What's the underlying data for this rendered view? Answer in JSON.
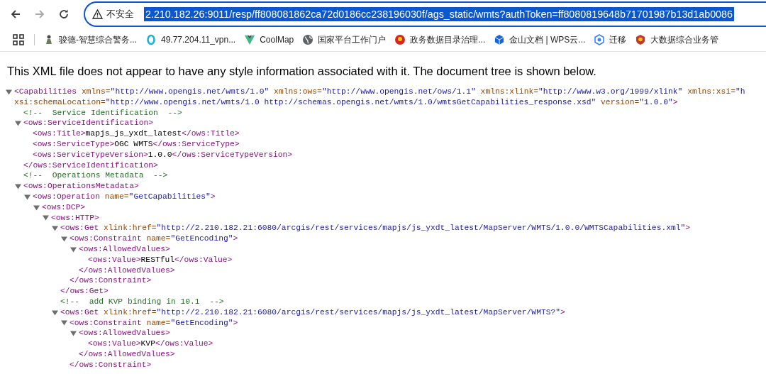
{
  "browser": {
    "nav": [
      {
        "kind": "back",
        "disabled": false
      },
      {
        "kind": "forward",
        "disabled": true
      },
      {
        "kind": "reload",
        "disabled": false
      }
    ],
    "omnibox": {
      "security_label": "不安全",
      "url": "2.210.182.26:9011/resp/ff808081862ca72d0186cc238196030f/ags_static/wmts?authToken=ff8080819648b71701987b13d1ab0086",
      "selected": true
    },
    "bookmarks": [
      {
        "kind": "figure",
        "label": "骏德-智慧综合警务..."
      },
      {
        "kind": "ring",
        "label": "49.77.204.11_vpn..."
      },
      {
        "kind": "vee",
        "label": "CoolMap"
      },
      {
        "kind": "globe",
        "label": "国家平台工作门户"
      },
      {
        "kind": "emblem",
        "label": "政务数据目录治理..."
      },
      {
        "kind": "cube",
        "label": "金山文档 | WPS云..."
      },
      {
        "kind": "hex",
        "label": "迁移"
      },
      {
        "kind": "badge",
        "label": "大数据综合业务管"
      }
    ]
  },
  "page": {
    "notice": "This XML file does not appear to have any style information associated with it. The document tree is shown below.",
    "tree": {
      "expanded": true,
      "lines": [
        [
          {
            "kind": "tag",
            "text": "<Capabilities"
          },
          {
            "kind": "attr",
            "text": " xmlns="
          },
          {
            "kind": "value",
            "text": "\"http://www.opengis.net/wmts/1.0\""
          },
          {
            "kind": "attr",
            "text": " xmlns:ows="
          },
          {
            "kind": "value",
            "text": "\"http://www.opengis.net/ows/1.1\""
          },
          {
            "kind": "attr",
            "text": " xmlns:xlink="
          },
          {
            "kind": "value",
            "text": "\"http://www.w3.org/1999/xlink\""
          },
          {
            "kind": "attr",
            "text": " xmlns:xsi="
          },
          {
            "kind": "value",
            "text": "\"h"
          }
        ],
        [
          {
            "kind": "attr",
            "text": "xsi:schemaLocation="
          },
          {
            "kind": "value",
            "text": "\"http://www.opengis.net/wmts/1.0 http://schemas.opengis.net/wmts/1.0/wmtsGetCapabilities_response.xsd\""
          },
          {
            "kind": "attr",
            "text": " version="
          },
          {
            "kind": "value",
            "text": "\"1.0.0\""
          },
          {
            "kind": "tag",
            "text": ">"
          }
        ]
      ],
      "children": [
        {
          "lines": [
            [
              {
                "kind": "comment",
                "text": "<!--  Service Identification  -->"
              }
            ]
          ]
        },
        {
          "expanded": true,
          "lines": [
            [
              {
                "kind": "tag",
                "text": "<ows:ServiceIdentification>"
              }
            ]
          ],
          "children": [
            {
              "lines": [
                [
                  {
                    "kind": "tag",
                    "text": "<ows:Title>"
                  },
                  {
                    "kind": "text",
                    "text": "mapjs_js_yxdt_latest"
                  },
                  {
                    "kind": "tag",
                    "text": "</ows:Title>"
                  }
                ]
              ]
            },
            {
              "lines": [
                [
                  {
                    "kind": "tag",
                    "text": "<ows:ServiceType>"
                  },
                  {
                    "kind": "text",
                    "text": "OGC WMTS"
                  },
                  {
                    "kind": "tag",
                    "text": "</ows:ServiceType>"
                  }
                ]
              ]
            },
            {
              "lines": [
                [
                  {
                    "kind": "tag",
                    "text": "<ows:ServiceTypeVersion>"
                  },
                  {
                    "kind": "text",
                    "text": "1.0.0"
                  },
                  {
                    "kind": "tag",
                    "text": "</ows:ServiceTypeVersion>"
                  }
                ]
              ]
            }
          ],
          "close": [
            {
              "kind": "tag",
              "text": "</ows:ServiceIdentification>"
            }
          ]
        },
        {
          "lines": [
            [
              {
                "kind": "comment",
                "text": "<!--  Operations Metadata  -->"
              }
            ]
          ]
        },
        {
          "expanded": true,
          "lines": [
            [
              {
                "kind": "tag",
                "text": "<ows:OperationsMetadata>"
              }
            ]
          ],
          "children": [
            {
              "expanded": true,
              "lines": [
                [
                  {
                    "kind": "tag",
                    "text": "<ows:Operation"
                  },
                  {
                    "kind": "attr",
                    "text": " name="
                  },
                  {
                    "kind": "value",
                    "text": "\"GetCapabilities\""
                  },
                  {
                    "kind": "tag",
                    "text": ">"
                  }
                ]
              ],
              "children": [
                {
                  "expanded": true,
                  "lines": [
                    [
                      {
                        "kind": "tag",
                        "text": "<ows:DCP>"
                      }
                    ]
                  ],
                  "children": [
                    {
                      "expanded": true,
                      "lines": [
                        [
                          {
                            "kind": "tag",
                            "text": "<ows:HTTP>"
                          }
                        ]
                      ],
                      "children": [
                        {
                          "expanded": true,
                          "lines": [
                            [
                              {
                                "kind": "tag",
                                "text": "<ows:Get"
                              },
                              {
                                "kind": "attr",
                                "text": " xlink:href="
                              },
                              {
                                "kind": "value",
                                "text": "\"http://2.210.182.21:6080/arcgis/rest/services/mapjs/js_yxdt_latest/MapServer/WMTS/1.0.0/WMTSCapabilities.xml\""
                              },
                              {
                                "kind": "tag",
                                "text": ">"
                              }
                            ]
                          ],
                          "children": [
                            {
                              "expanded": true,
                              "lines": [
                                [
                                  {
                                    "kind": "tag",
                                    "text": "<ows:Constraint"
                                  },
                                  {
                                    "kind": "attr",
                                    "text": " name="
                                  },
                                  {
                                    "kind": "value",
                                    "text": "\"GetEncoding\""
                                  },
                                  {
                                    "kind": "tag",
                                    "text": ">"
                                  }
                                ]
                              ],
                              "children": [
                                {
                                  "expanded": true,
                                  "lines": [
                                    [
                                      {
                                        "kind": "tag",
                                        "text": "<ows:AllowedValues>"
                                      }
                                    ]
                                  ],
                                  "children": [
                                    {
                                      "lines": [
                                        [
                                          {
                                            "kind": "tag",
                                            "text": "<ows:Value>"
                                          },
                                          {
                                            "kind": "text",
                                            "text": "RESTful"
                                          },
                                          {
                                            "kind": "tag",
                                            "text": "</ows:Value>"
                                          }
                                        ]
                                      ]
                                    }
                                  ],
                                  "close": [
                                    {
                                      "kind": "tag",
                                      "text": "</ows:AllowedValues>"
                                    }
                                  ]
                                }
                              ],
                              "close": [
                                {
                                  "kind": "tag",
                                  "text": "</ows:Constraint>"
                                }
                              ]
                            }
                          ],
                          "close": [
                            {
                              "kind": "tag",
                              "text": "</ows:Get>"
                            }
                          ]
                        },
                        {
                          "lines": [
                            [
                              {
                                "kind": "comment",
                                "text": "<!--  add KVP binding in 10.1  -->"
                              }
                            ]
                          ]
                        },
                        {
                          "expanded": true,
                          "lines": [
                            [
                              {
                                "kind": "tag",
                                "text": "<ows:Get"
                              },
                              {
                                "kind": "attr",
                                "text": " xlink:href="
                              },
                              {
                                "kind": "value",
                                "text": "\"http://2.210.182.21:6080/arcgis/rest/services/mapjs/js_yxdt_latest/MapServer/WMTS?\""
                              },
                              {
                                "kind": "tag",
                                "text": ">"
                              }
                            ]
                          ],
                          "children": [
                            {
                              "expanded": true,
                              "lines": [
                                [
                                  {
                                    "kind": "tag",
                                    "text": "<ows:Constraint"
                                  },
                                  {
                                    "kind": "attr",
                                    "text": " name="
                                  },
                                  {
                                    "kind": "value",
                                    "text": "\"GetEncoding\""
                                  },
                                  {
                                    "kind": "tag",
                                    "text": ">"
                                  }
                                ]
                              ],
                              "children": [
                                {
                                  "expanded": true,
                                  "lines": [
                                    [
                                      {
                                        "kind": "tag",
                                        "text": "<ows:AllowedValues>"
                                      }
                                    ]
                                  ],
                                  "children": [
                                    {
                                      "lines": [
                                        [
                                          {
                                            "kind": "tag",
                                            "text": "<ows:Value>"
                                          },
                                          {
                                            "kind": "text",
                                            "text": "KVP"
                                          },
                                          {
                                            "kind": "tag",
                                            "text": "</ows:Value>"
                                          }
                                        ]
                                      ]
                                    }
                                  ],
                                  "close": [
                                    {
                                      "kind": "tag",
                                      "text": "</ows:AllowedValues>"
                                    }
                                  ]
                                }
                              ],
                              "close": [
                                {
                                  "kind": "tag",
                                  "text": "</ows:Constraint>"
                                }
                              ]
                            }
                          ]
                        }
                      ]
                    }
                  ]
                }
              ]
            }
          ]
        }
      ]
    }
  }
}
